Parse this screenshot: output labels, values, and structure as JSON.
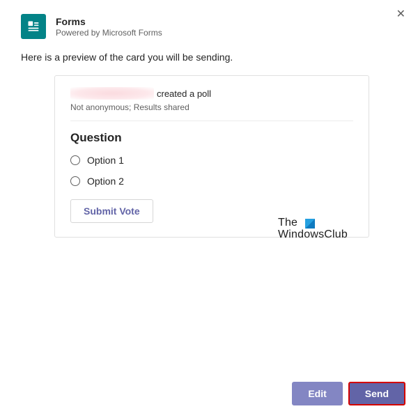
{
  "header": {
    "title": "Forms",
    "subtitle": "Powered by Microsoft Forms"
  },
  "preview_intro": "Here is a preview of the card you will be sending.",
  "card": {
    "created_suffix": "created a poll",
    "meta": "Not anonymous; Results shared",
    "question_title": "Question",
    "options": [
      {
        "label": "Option 1"
      },
      {
        "label": "Option 2"
      }
    ],
    "submit_label": "Submit Vote"
  },
  "watermark": {
    "line1": "The",
    "line2": "WindowsClub"
  },
  "footer": {
    "edit_label": "Edit",
    "send_label": "Send"
  }
}
